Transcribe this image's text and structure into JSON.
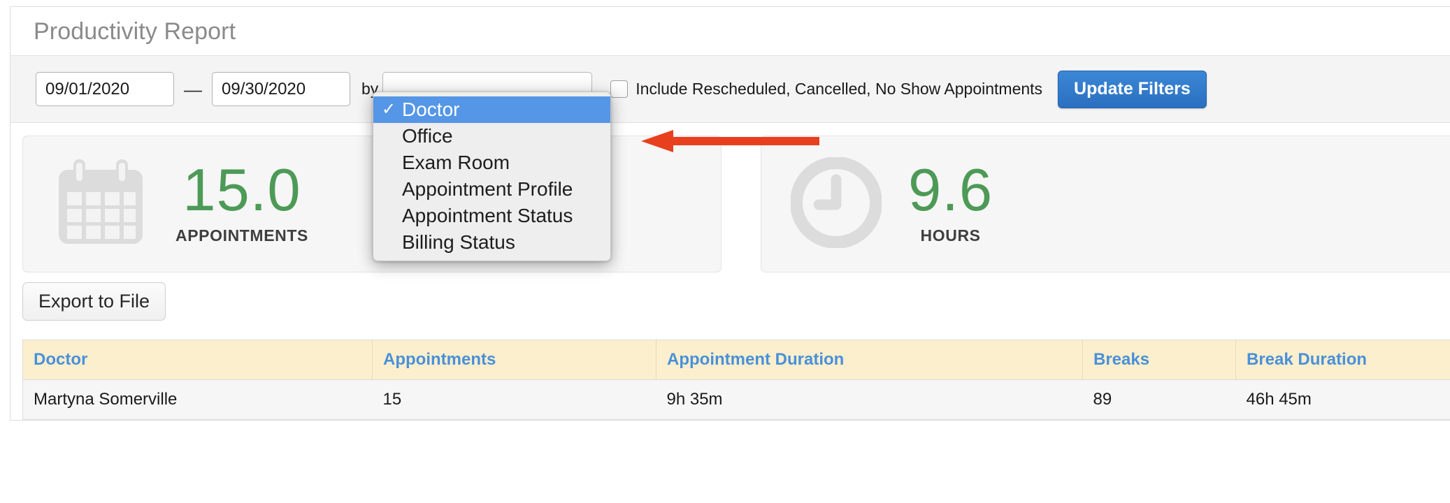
{
  "header": {
    "title": "Productivity Report"
  },
  "filters": {
    "start_date": "09/01/2020",
    "end_date": "09/30/2020",
    "date_separator": "—",
    "by_label": "by",
    "group_by_selected": "Doctor",
    "group_by_options": [
      "Doctor",
      "Office",
      "Exam Room",
      "Appointment Profile",
      "Appointment Status",
      "Billing Status"
    ],
    "checkmark_glyph": "✓",
    "include_checkbox_label": "Include Rescheduled, Cancelled, No Show Appointments",
    "include_checkbox_checked": false,
    "update_button_label": "Update Filters",
    "accent_blue": "#2b6fc0",
    "highlight_blue": "#5596e6"
  },
  "annotation": {
    "arrow_color": "#e8401f",
    "arrow_direction": "left"
  },
  "stats": [
    {
      "icon": "calendar-icon",
      "value": "15.0",
      "label": "APPOINTMENTS",
      "value_color": "#4d9a57"
    },
    {
      "icon": "clock-icon",
      "value": "9.6",
      "label": "HOURS",
      "value_color": "#4d9a57"
    }
  ],
  "export": {
    "button_label": "Export to File"
  },
  "table": {
    "columns": [
      "Doctor",
      "Appointments",
      "Appointment Duration",
      "Breaks",
      "Break Duration"
    ],
    "header_bg": "#fcefcd",
    "header_text_color": "#4a90d9",
    "rows": [
      {
        "doctor": "Martyna Somerville",
        "appointments": "15",
        "appointment_duration": "9h 35m",
        "breaks": "89",
        "break_duration": "46h 45m"
      }
    ]
  }
}
